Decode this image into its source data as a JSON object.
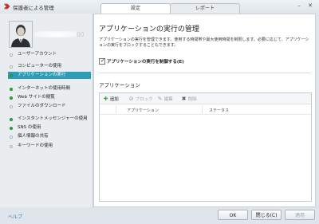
{
  "window": {
    "title": "保護者による管理",
    "tabs": [
      "設定",
      "レポート"
    ],
    "accent_color": "#2c9cb7",
    "logo_color": "#c62828"
  },
  "user": {
    "name_visible": "00"
  },
  "sidebar": {
    "items": [
      {
        "label": "ユーザーアカウント",
        "status": "neutral",
        "selected": false
      },
      {
        "label": "コンピューターの使用",
        "status": "neutral",
        "selected": false
      },
      {
        "label": "アプリケーションの実行",
        "status": "green",
        "selected": true
      },
      {
        "label": "インターネットの使用時間",
        "status": "green",
        "selected": false
      },
      {
        "label": "Web サイトの閲覧",
        "status": "green",
        "selected": false
      },
      {
        "label": "ファイルのダウンロード",
        "status": "neutral",
        "selected": false
      },
      {
        "label": "インスタントメッセンジャーの使用",
        "status": "green",
        "selected": false
      },
      {
        "label": "SNS の使用",
        "status": "green",
        "selected": false
      },
      {
        "label": "個人情報の共有",
        "status": "neutral",
        "selected": false
      },
      {
        "label": "キーワードの使用",
        "status": "neutral",
        "selected": false
      }
    ]
  },
  "main": {
    "heading": "アプリケーションの実行の管理",
    "description": "アプリケーションの実行を管理できます。使用する時間帯や最大使用時間を制限します。必要に応じて、アプリケーションの実行をブロックすることもできます。",
    "checkbox": {
      "label": "アプリケーションの実行を制御する(E)",
      "checked": true
    },
    "section_title": "アプリケーション",
    "toolbar": {
      "add": "追加",
      "block": "ブロック",
      "edit": "編集",
      "delete": "削除"
    },
    "columns": [
      "アプリケーション",
      "ステータス"
    ]
  },
  "footer": {
    "help": "ヘルプ",
    "ok": "OK",
    "close": "閉じる(C)",
    "apply": "適用"
  }
}
